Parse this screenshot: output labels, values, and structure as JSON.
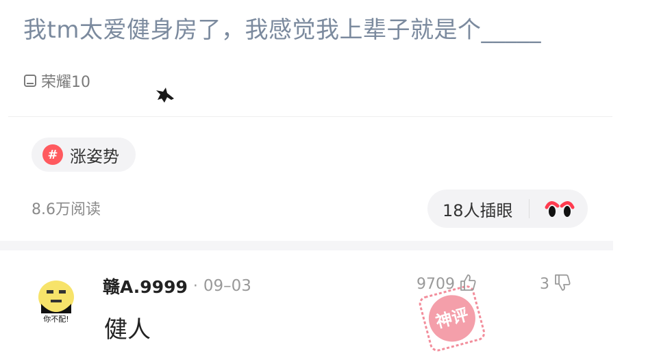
{
  "post": {
    "title": "我tm太爱健身房了，我感觉我上辈子就是个_____",
    "device": "荣耀10"
  },
  "tag": {
    "icon_glyph": "#",
    "label": "涨姿势"
  },
  "stats": {
    "reads": "8.6万阅读",
    "peek_label": "18人插眼"
  },
  "comment": {
    "username": "赣A.9999",
    "separator": "·",
    "date": "09–03",
    "text": "健人",
    "avatar_caption": "你不配!",
    "likes": "9709",
    "dislikes": "3",
    "stamp_text": "神评"
  },
  "colors": {
    "title": "#7b8a9e",
    "tag_icon": "#ff5a5f",
    "stamp": "#f07a8a",
    "muted": "#999999"
  },
  "icons": [
    "device-icon",
    "cursor-mark",
    "hashtag-icon",
    "eyes-icon",
    "thumbs-up-icon",
    "thumbs-down-icon",
    "god-comment-stamp"
  ]
}
